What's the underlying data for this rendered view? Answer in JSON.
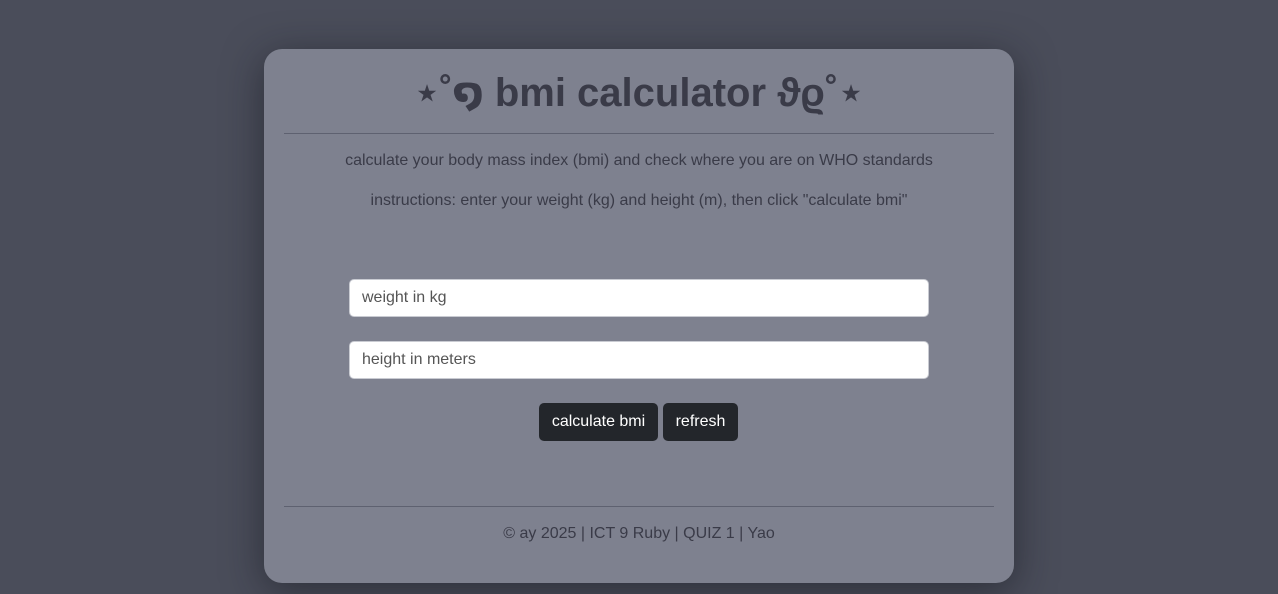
{
  "card": {
    "title": "⋆˚໑ bmi calculator ϑϱ˚⋆",
    "description": "calculate your body mass index (bmi) and check where you are on WHO standards",
    "instructions": "instructions: enter your weight (kg) and height (m), then click \"calculate bmi\""
  },
  "form": {
    "weight_placeholder": "weight in kg",
    "weight_value": "",
    "height_placeholder": "height in meters",
    "height_value": ""
  },
  "buttons": {
    "calculate_label": "calculate bmi",
    "refresh_label": "refresh"
  },
  "footer": {
    "text": "© ay 2025 | ICT 9 Ruby | QUIZ 1 | Yao"
  },
  "colors": {
    "page_background": "#4a4d5a",
    "card_background": "#7e818f",
    "text": "#3a3b48",
    "button_background": "#23262b"
  }
}
